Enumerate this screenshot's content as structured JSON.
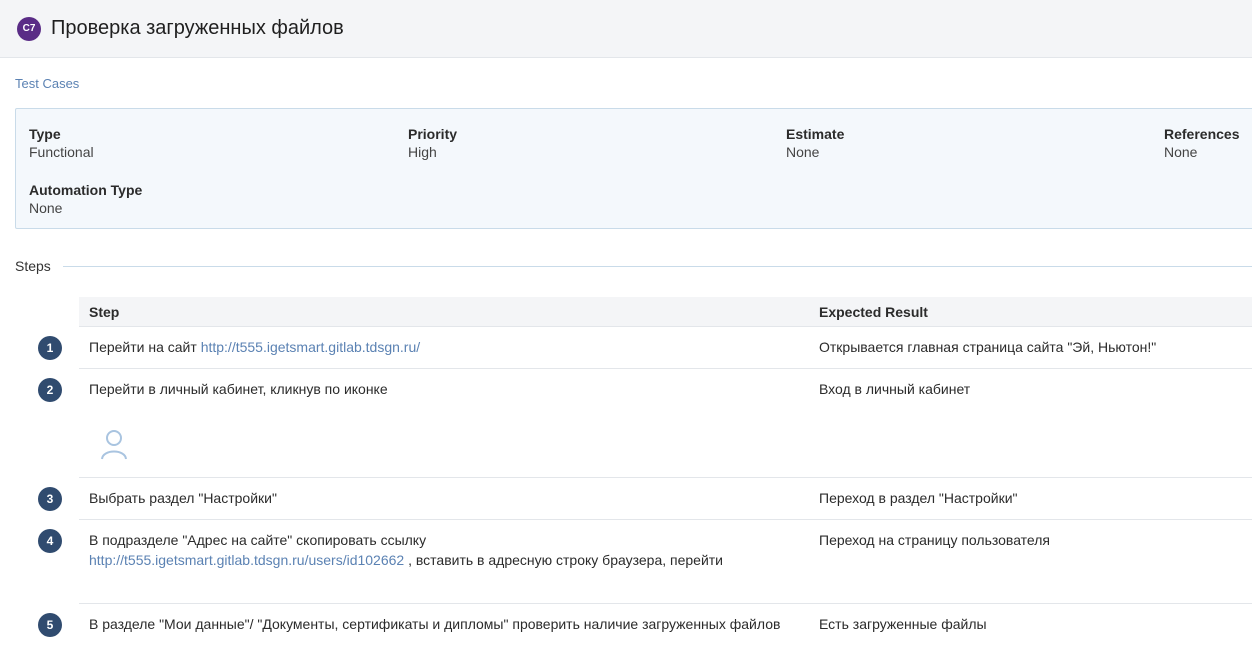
{
  "header": {
    "case_id": "C7",
    "title": "Проверка загруженных файлов"
  },
  "breadcrumb": "Test Cases",
  "properties": {
    "type": {
      "label": "Type",
      "value": "Functional"
    },
    "priority": {
      "label": "Priority",
      "value": "High"
    },
    "estimate": {
      "label": "Estimate",
      "value": "None"
    },
    "references": {
      "label": "References",
      "value": "None"
    },
    "automation_type": {
      "label": "Automation Type",
      "value": "None"
    }
  },
  "steps_section": {
    "title": "Steps"
  },
  "table": {
    "col_step": "Step",
    "col_expected": "Expected Result"
  },
  "steps": [
    {
      "num": "1",
      "text_before": "Перейти на сайт ",
      "link": "http://t555.igetsmart.gitlab.tdsgn.ru/",
      "expected": "Открывается главная страница сайта \"Эй, Ньютон!\""
    },
    {
      "num": "2",
      "text": "Перейти в личный кабинет, кликнув по иконке",
      "icon": "user-icon",
      "expected": "Вход в личный кабинет"
    },
    {
      "num": "3",
      "text": "Выбрать раздел \"Настройки\"",
      "expected": "Переход в раздел \"Настройки\""
    },
    {
      "num": "4",
      "text_before": "В подразделе \"Адрес на сайте\" скопировать ссылку",
      "link": "http://t555.igetsmart.gitlab.tdsgn.ru/users/id102662",
      "text_after": " , вставить в адресную строку браузера, перейти",
      "expected": "Переход на страницу пользователя"
    },
    {
      "num": "5",
      "text": "В разделе \"Мои данные\"/ \"Документы, сертификаты и дипломы\" проверить наличие загруженных файлов",
      "expected": "Есть загруженные файлы"
    }
  ],
  "colors": {
    "badge": "#5a2c86",
    "step_number": "#304b6f",
    "link": "#5b82b3"
  }
}
